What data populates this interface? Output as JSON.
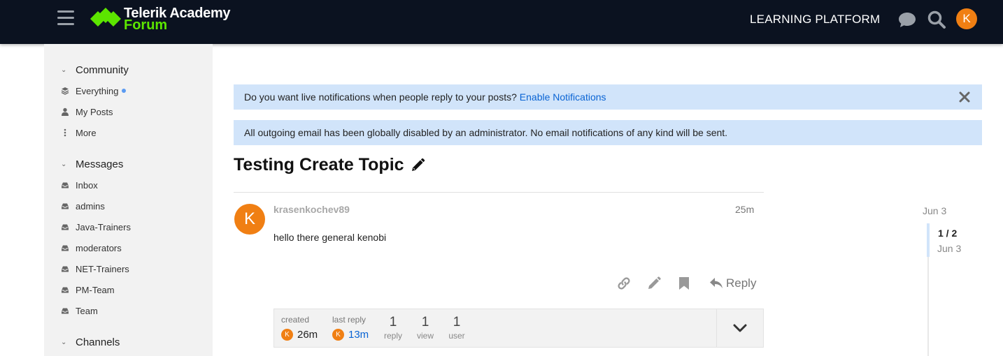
{
  "header": {
    "logo_line1": "Telerik Academy",
    "logo_line2": "Forum",
    "learning_platform": "LEARNING PLATFORM",
    "avatar_letter": "K",
    "colors": {
      "background": "#0b1220",
      "logo_green": "#5ce500",
      "avatar": "#f07f13"
    },
    "icons": [
      "hamburger-icon",
      "chat-icon",
      "search-icon"
    ]
  },
  "sidebar": {
    "sections": [
      {
        "title": "Community",
        "items": [
          {
            "label": "Everything",
            "icon": "layers-icon",
            "unread_dot": true
          },
          {
            "label": "My Posts",
            "icon": "user-icon"
          },
          {
            "label": "More",
            "icon": "ellipsis-vertical-icon"
          }
        ]
      },
      {
        "title": "Messages",
        "items": [
          {
            "label": "Inbox",
            "icon": "inbox-icon"
          },
          {
            "label": "admins",
            "icon": "inbox-icon"
          },
          {
            "label": "Java-Trainers",
            "icon": "inbox-icon"
          },
          {
            "label": "moderators",
            "icon": "inbox-icon"
          },
          {
            "label": "NET-Trainers",
            "icon": "inbox-icon"
          },
          {
            "label": "PM-Team",
            "icon": "inbox-icon"
          },
          {
            "label": "Team",
            "icon": "inbox-icon"
          }
        ]
      },
      {
        "title": "Channels",
        "items": []
      }
    ]
  },
  "banners": {
    "notifications_text": "Do you want live notifications when people reply to your posts?",
    "notifications_link": "Enable Notifications",
    "email_disabled_text": "All outgoing email has been globally disabled by an administrator. No email notifications of any kind will be sent.",
    "color": "#d1e4fa"
  },
  "topic": {
    "title": "Testing Create Topic",
    "post": {
      "avatar_letter": "K",
      "username": "krasenkochev89",
      "time": "25m",
      "body": "hello there general kenobi",
      "actions": {
        "reply_label": "Reply"
      }
    },
    "topic_map": {
      "created_label": "created",
      "created_value": "26m",
      "last_reply_label": "last reply",
      "last_reply_value": "13m",
      "replies_count": "1",
      "replies_label": "reply",
      "views_count": "1",
      "views_label": "view",
      "users_count": "1",
      "users_label": "user",
      "avatar_letter": "K"
    }
  },
  "timeline": {
    "start_date": "Jun 3",
    "position": "1 / 2",
    "current_date": "Jun 3"
  }
}
